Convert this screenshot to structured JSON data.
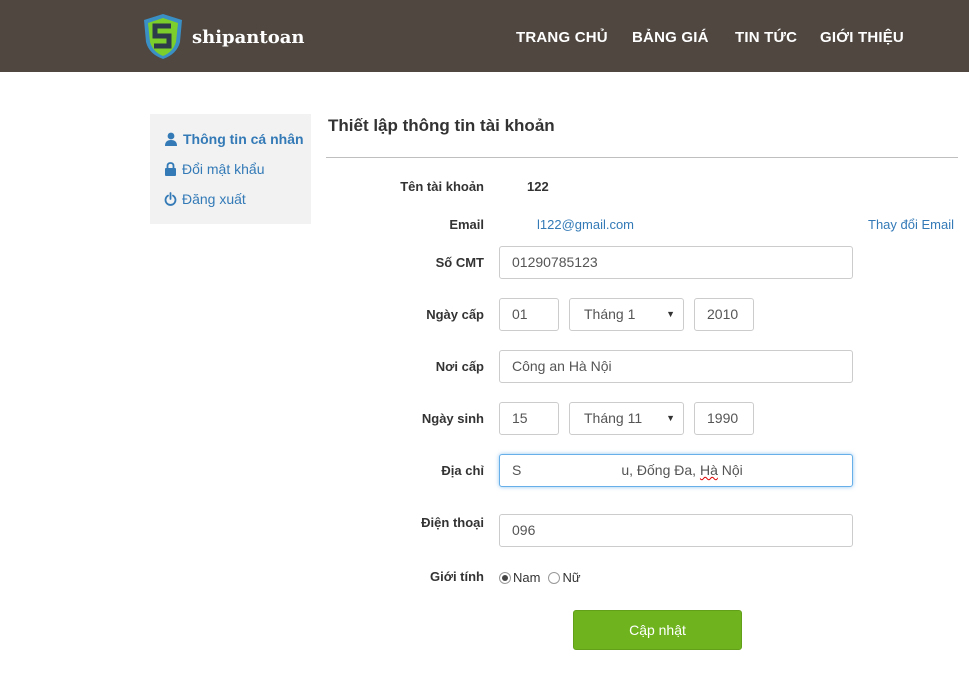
{
  "header": {
    "logo_text": "shipantoan",
    "nav": [
      "TRANG CHỦ",
      "BẢNG GIÁ",
      "TIN TỨC",
      "GIỚI THIỆU"
    ]
  },
  "sidebar": {
    "items": [
      {
        "label": "Thông tin cá nhân",
        "icon": "user-icon"
      },
      {
        "label": "Đổi mật khẩu",
        "icon": "lock-icon"
      },
      {
        "label": "Đăng xuất",
        "icon": "power-icon"
      }
    ]
  },
  "page": {
    "title": "Thiết lập thông tin tài khoản"
  },
  "form": {
    "username": {
      "label": "Tên tài khoản",
      "value": "122"
    },
    "email": {
      "label": "Email",
      "value": "l122@gmail.com",
      "change_link": "Thay đổi Email"
    },
    "id_number": {
      "label": "Số CMT",
      "value": "01290785123"
    },
    "issue_date": {
      "label": "Ngày cấp",
      "day": "01",
      "month": "Tháng 1",
      "year": "2010"
    },
    "issue_place": {
      "label": "Nơi cấp",
      "value": "Công an Hà Nội"
    },
    "birth_date": {
      "label": "Ngày sinh",
      "day": "15",
      "month": "Tháng 11",
      "year": "1990"
    },
    "address": {
      "label": "Địa chỉ",
      "value_prefix": "S",
      "value_suffix": "u, Đống Đa, ",
      "value_underlined": "Hà",
      "value_end": " Nội"
    },
    "phone": {
      "label": "Điện thoại",
      "value": "096"
    },
    "gender": {
      "label": "Giới tính",
      "options": [
        "Nam",
        "Nữ"
      ],
      "selected": "Nam"
    },
    "submit_label": "Cập nhật"
  },
  "colors": {
    "header_bg": "#4f4740",
    "link": "#337ab7",
    "submit": "#6fb41f",
    "focus_border": "#66afe9"
  }
}
